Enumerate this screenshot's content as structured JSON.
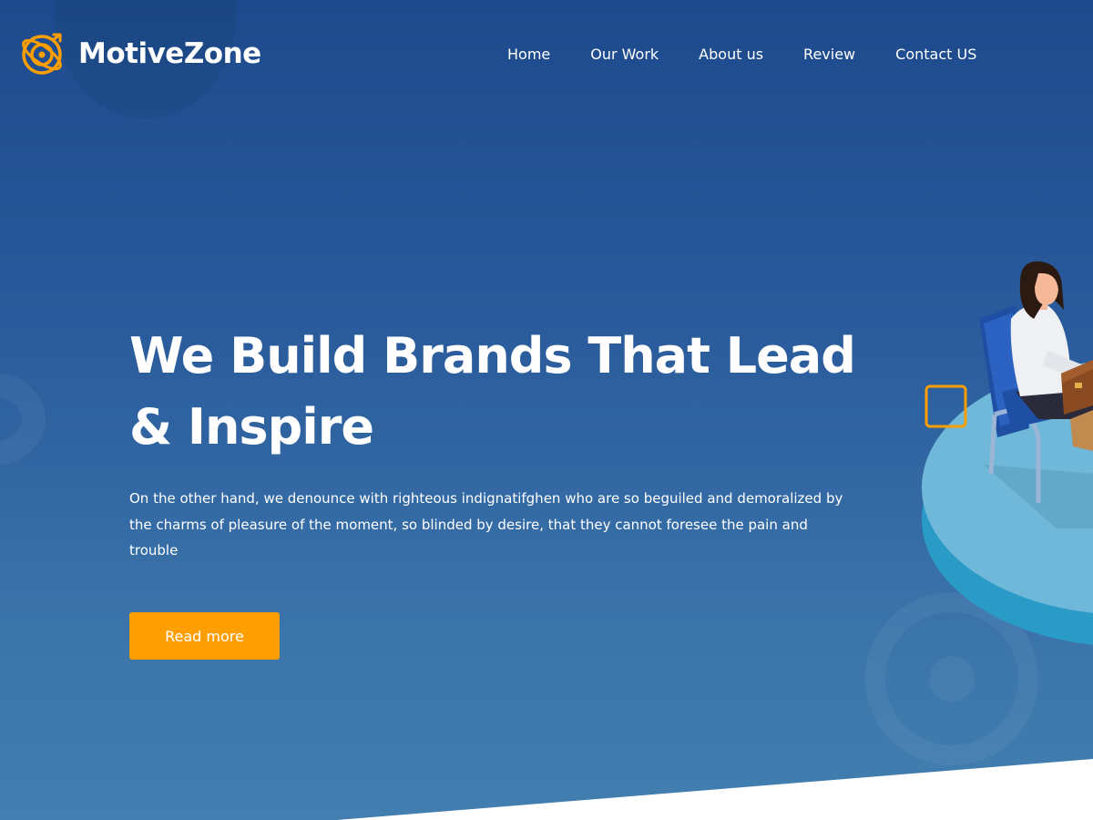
{
  "brand": {
    "name": "MotiveZone",
    "logo_icon": "target-arrow-icon",
    "accent_color": "#ff9e01"
  },
  "nav": {
    "items": [
      {
        "label": "Home"
      },
      {
        "label": "Our Work"
      },
      {
        "label": "About us"
      },
      {
        "label": "Review"
      },
      {
        "label": "Contact US"
      }
    ]
  },
  "hero": {
    "headline_line1": "We Build Brands That Lead",
    "headline_line2": "& Inspire",
    "paragraph": "On the other hand, we denounce with righteous indignatifghen who are so beguiled and demoralized by the charms of pleasure of the moment, so blinded by desire, that they cannot foresee the pain and trouble",
    "cta_label": "Read more",
    "illustration": "woman-at-desk-illustration",
    "background_top_color": "#1d4a8c",
    "background_bottom_color": "#427fb0"
  }
}
